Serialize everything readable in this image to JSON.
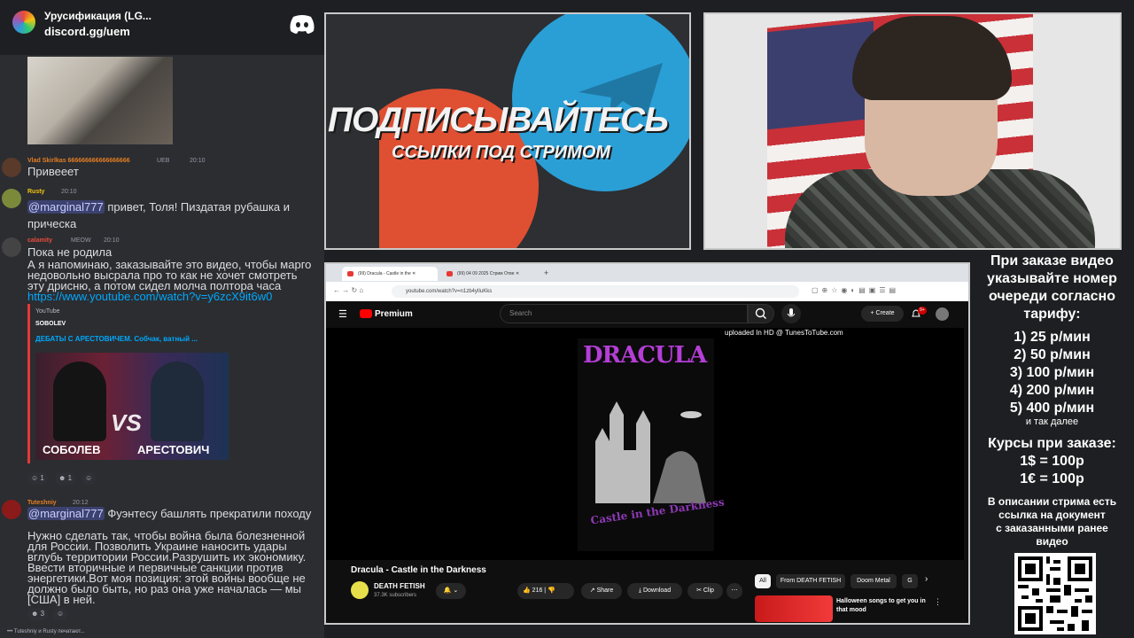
{
  "chat": {
    "server_name": "Урусификация (LG...",
    "server_invite": "discord.gg/uem",
    "messages": [
      {
        "user": "Vlad Skirlkas 666666666666666666",
        "badge": "UEB",
        "time": "20:10",
        "text": "Привееет"
      },
      {
        "user": "Rusty",
        "time": "20:10",
        "mention": "@marginal777",
        "text": "привет, Толя! Пиздатая рубашка и прическа"
      },
      {
        "user": "calamity",
        "badge": "MEOW",
        "time": "20:10",
        "text_lines": [
          "Пока не родила",
          "А я напоминаю, заказывайте это видео, чтобы марго",
          "недовольно высрала про то как не хочет смотреть",
          "эту дрисню, а потом сидел молча полтора часа"
        ],
        "link": "https://www.youtube.com/watch?v=y6zcX9it6w0"
      },
      {
        "user": "Tuteshniy",
        "time": "20:12",
        "mention": "@marginal777",
        "text": "Фуэнтесу башлять прекратили походу",
        "text_lines": [
          "Нужно сделать так, чтобы война была болезненной",
          "для России. Позволить Украине наносить удары",
          "вглубь территории России.Разрушить их экономику.",
          "Ввести вторичные и первичные санкции против",
          "энергетики.Вот моя позиция: этой войны вообще не",
          "должно было быть, но раз она уже началась — мы",
          "[США] в ней."
        ]
      }
    ],
    "embed": {
      "source": "YouTube",
      "author": "SOBOLEV",
      "title": "ДЕБАТЫ С АРЕСТОВИЧЕМ. Собчак, ватный ...",
      "thumb_left": "СОБОЛЕВ",
      "thumb_vs": "VS",
      "thumb_right": "АРЕСТОВИЧ"
    },
    "reactions_1": [
      "1",
      "1"
    ],
    "reactions_2": [
      "3"
    ],
    "typing": "Tuteshniy и Rusty печатают..."
  },
  "banner": {
    "main": "ПОДПИСЫВАЙТЕСЬ",
    "sub": "ССЫЛКИ ПОД СТРИМОМ"
  },
  "browser": {
    "tabs": [
      "(99) Dracula - Castle in the",
      "(99) 04 09 2025 Стрим Отве"
    ],
    "url": "youtube.com/watch?v=n1zb4yIluKks",
    "yt": {
      "brand": "Premium",
      "search_placeholder": "Search",
      "create": "Create",
      "notifications": "9+",
      "uploaded": "uploaded In HD @ TunesToTube.com",
      "cover_title": "DRACULA",
      "cover_sub": "Castle in the Darkness",
      "video_title": "Dracula - Castle in the Darkness",
      "channel": "DEATH FETISH",
      "subs": "37.3K subscribers",
      "likes": "216",
      "share": "Share",
      "download": "Download",
      "clip": "Clip",
      "chips": [
        "All",
        "From DEATH FETISH",
        "Doom Metal",
        "G"
      ],
      "rec_title": "Halloween songs to get you in that mood"
    }
  },
  "info": {
    "intro": [
      "При заказе видео",
      "указывайте номер",
      "очереди согласно",
      "тарифу:"
    ],
    "tariffs": [
      "1) 25 р/мин",
      "2) 50 р/мин",
      "3) 100 р/мин",
      "4) 200 р/мин",
      "5) 400 р/мин"
    ],
    "etc": "и так далее",
    "rates_title": "Курсы при заказе:",
    "rates": [
      "1$ = 100р",
      "1€ = 100р"
    ],
    "doc_note": [
      "В описании стрима есть",
      "ссылка на документ",
      "с заказанными ранее",
      "видео"
    ]
  },
  "colors": {
    "discord_bg": "#2b2d31",
    "mention_bg": "#3c4270",
    "link": "#00a8fc",
    "yt_red": "#ff0000",
    "telegram": "#2a9fd6",
    "patreon": "#ff5533"
  }
}
